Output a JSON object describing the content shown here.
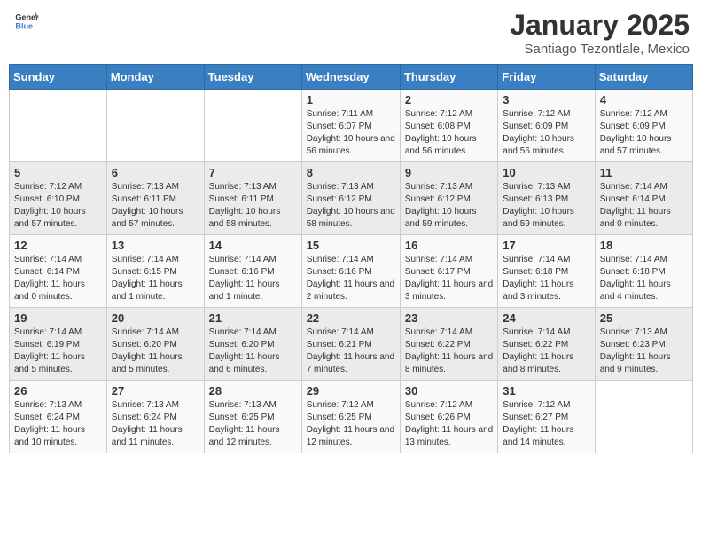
{
  "header": {
    "logo_general": "General",
    "logo_blue": "Blue",
    "month": "January 2025",
    "location": "Santiago Tezontlale, Mexico"
  },
  "weekdays": [
    "Sunday",
    "Monday",
    "Tuesday",
    "Wednesday",
    "Thursday",
    "Friday",
    "Saturday"
  ],
  "weeks": [
    [
      {
        "day": "",
        "info": ""
      },
      {
        "day": "",
        "info": ""
      },
      {
        "day": "",
        "info": ""
      },
      {
        "day": "1",
        "info": "Sunrise: 7:11 AM\nSunset: 6:07 PM\nDaylight: 10 hours and 56 minutes."
      },
      {
        "day": "2",
        "info": "Sunrise: 7:12 AM\nSunset: 6:08 PM\nDaylight: 10 hours and 56 minutes."
      },
      {
        "day": "3",
        "info": "Sunrise: 7:12 AM\nSunset: 6:09 PM\nDaylight: 10 hours and 56 minutes."
      },
      {
        "day": "4",
        "info": "Sunrise: 7:12 AM\nSunset: 6:09 PM\nDaylight: 10 hours and 57 minutes."
      }
    ],
    [
      {
        "day": "5",
        "info": "Sunrise: 7:12 AM\nSunset: 6:10 PM\nDaylight: 10 hours and 57 minutes."
      },
      {
        "day": "6",
        "info": "Sunrise: 7:13 AM\nSunset: 6:11 PM\nDaylight: 10 hours and 57 minutes."
      },
      {
        "day": "7",
        "info": "Sunrise: 7:13 AM\nSunset: 6:11 PM\nDaylight: 10 hours and 58 minutes."
      },
      {
        "day": "8",
        "info": "Sunrise: 7:13 AM\nSunset: 6:12 PM\nDaylight: 10 hours and 58 minutes."
      },
      {
        "day": "9",
        "info": "Sunrise: 7:13 AM\nSunset: 6:12 PM\nDaylight: 10 hours and 59 minutes."
      },
      {
        "day": "10",
        "info": "Sunrise: 7:13 AM\nSunset: 6:13 PM\nDaylight: 10 hours and 59 minutes."
      },
      {
        "day": "11",
        "info": "Sunrise: 7:14 AM\nSunset: 6:14 PM\nDaylight: 11 hours and 0 minutes."
      }
    ],
    [
      {
        "day": "12",
        "info": "Sunrise: 7:14 AM\nSunset: 6:14 PM\nDaylight: 11 hours and 0 minutes."
      },
      {
        "day": "13",
        "info": "Sunrise: 7:14 AM\nSunset: 6:15 PM\nDaylight: 11 hours and 1 minute."
      },
      {
        "day": "14",
        "info": "Sunrise: 7:14 AM\nSunset: 6:16 PM\nDaylight: 11 hours and 1 minute."
      },
      {
        "day": "15",
        "info": "Sunrise: 7:14 AM\nSunset: 6:16 PM\nDaylight: 11 hours and 2 minutes."
      },
      {
        "day": "16",
        "info": "Sunrise: 7:14 AM\nSunset: 6:17 PM\nDaylight: 11 hours and 3 minutes."
      },
      {
        "day": "17",
        "info": "Sunrise: 7:14 AM\nSunset: 6:18 PM\nDaylight: 11 hours and 3 minutes."
      },
      {
        "day": "18",
        "info": "Sunrise: 7:14 AM\nSunset: 6:18 PM\nDaylight: 11 hours and 4 minutes."
      }
    ],
    [
      {
        "day": "19",
        "info": "Sunrise: 7:14 AM\nSunset: 6:19 PM\nDaylight: 11 hours and 5 minutes."
      },
      {
        "day": "20",
        "info": "Sunrise: 7:14 AM\nSunset: 6:20 PM\nDaylight: 11 hours and 5 minutes."
      },
      {
        "day": "21",
        "info": "Sunrise: 7:14 AM\nSunset: 6:20 PM\nDaylight: 11 hours and 6 minutes."
      },
      {
        "day": "22",
        "info": "Sunrise: 7:14 AM\nSunset: 6:21 PM\nDaylight: 11 hours and 7 minutes."
      },
      {
        "day": "23",
        "info": "Sunrise: 7:14 AM\nSunset: 6:22 PM\nDaylight: 11 hours and 8 minutes."
      },
      {
        "day": "24",
        "info": "Sunrise: 7:14 AM\nSunset: 6:22 PM\nDaylight: 11 hours and 8 minutes."
      },
      {
        "day": "25",
        "info": "Sunrise: 7:13 AM\nSunset: 6:23 PM\nDaylight: 11 hours and 9 minutes."
      }
    ],
    [
      {
        "day": "26",
        "info": "Sunrise: 7:13 AM\nSunset: 6:24 PM\nDaylight: 11 hours and 10 minutes."
      },
      {
        "day": "27",
        "info": "Sunrise: 7:13 AM\nSunset: 6:24 PM\nDaylight: 11 hours and 11 minutes."
      },
      {
        "day": "28",
        "info": "Sunrise: 7:13 AM\nSunset: 6:25 PM\nDaylight: 11 hours and 12 minutes."
      },
      {
        "day": "29",
        "info": "Sunrise: 7:12 AM\nSunset: 6:25 PM\nDaylight: 11 hours and 12 minutes."
      },
      {
        "day": "30",
        "info": "Sunrise: 7:12 AM\nSunset: 6:26 PM\nDaylight: 11 hours and 13 minutes."
      },
      {
        "day": "31",
        "info": "Sunrise: 7:12 AM\nSunset: 6:27 PM\nDaylight: 11 hours and 14 minutes."
      },
      {
        "day": "",
        "info": ""
      }
    ]
  ]
}
